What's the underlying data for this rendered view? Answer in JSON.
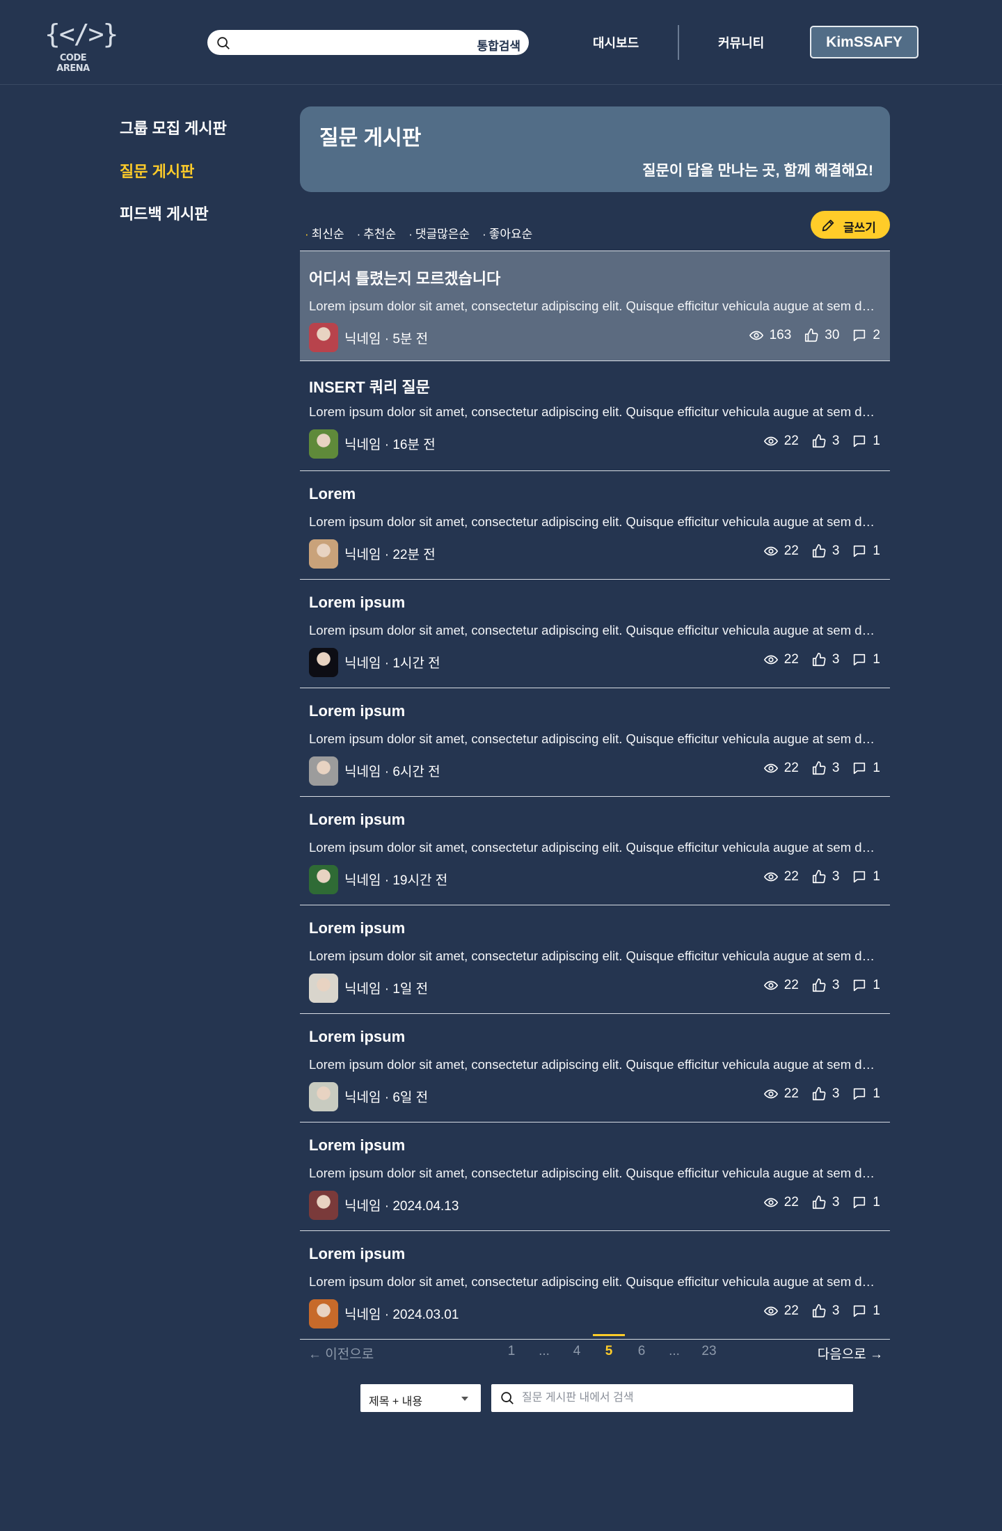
{
  "header": {
    "logo_text": "CODE ARENA",
    "search_label": "통합검색",
    "nav": [
      "대시보드",
      "커뮤니티"
    ],
    "user": "KimSSAFY"
  },
  "sidebar": {
    "items": [
      {
        "label": "그룹 모집 게시판",
        "active": false
      },
      {
        "label": "질문 게시판",
        "active": true
      },
      {
        "label": "피드백 게시판",
        "active": false
      }
    ]
  },
  "board": {
    "title": "질문 게시판",
    "subtitle": "질문이 답을 만나는 곳, 함께 해결해요!"
  },
  "sort": {
    "tabs": [
      "최신순",
      "추천순",
      "댓글많은순",
      "좋아요순"
    ],
    "active_index": 0
  },
  "write_label": "글쓰기",
  "posts": [
    {
      "title": "어디서 틀렸는지 모르겠습니다",
      "body": "Lorem ipsum dolor sit amet, consectetur adipiscing elit. Quisque efficitur vehicula augue at sem dapibus, non volutpat",
      "meta": "닉네임 · 5분 전",
      "views": "163",
      "likes": "30",
      "comments": "2",
      "highlight": true,
      "avatar_color": "#b8434c"
    },
    {
      "title": "INSERT 쿼리 질문",
      "body": "Lorem ipsum dolor sit amet, consectetur adipiscing elit. Quisque efficitur vehicula augue at sem dapibus, non volutpat",
      "meta": "닉네임 · 16분 전",
      "views": "22",
      "likes": "3",
      "comments": "1",
      "highlight": false,
      "avatar_color": "#5f8a3a"
    },
    {
      "title": "Lorem",
      "body": "Lorem ipsum dolor sit amet, consectetur adipiscing elit. Quisque efficitur vehicula augue at sem dapibus, non volutpat",
      "meta": "닉네임 · 22분 전",
      "views": "22",
      "likes": "3",
      "comments": "1",
      "highlight": false,
      "avatar_color": "#c9a27a"
    },
    {
      "title": "Lorem ipsum",
      "body": "Lorem ipsum dolor sit amet, consectetur adipiscing elit. Quisque efficitur vehicula augue at sem dapibus, non volutpat",
      "meta": "닉네임 · 1시간 전",
      "views": "22",
      "likes": "3",
      "comments": "1",
      "highlight": false,
      "avatar_color": "#0d0d14"
    },
    {
      "title": "Lorem ipsum",
      "body": "Lorem ipsum dolor sit amet, consectetur adipiscing elit. Quisque efficitur vehicula augue at sem dapibus, non volutpat",
      "meta": "닉네임 · 6시간 전",
      "views": "22",
      "likes": "3",
      "comments": "1",
      "highlight": false,
      "avatar_color": "#9c9c9c"
    },
    {
      "title": "Lorem ipsum",
      "body": "Lorem ipsum dolor sit amet, consectetur adipiscing elit. Quisque efficitur vehicula augue at sem dapibus, non volutpat",
      "meta": "닉네임 · 19시간 전",
      "views": "22",
      "likes": "3",
      "comments": "1",
      "highlight": false,
      "avatar_color": "#2f6b35"
    },
    {
      "title": "Lorem ipsum",
      "body": "Lorem ipsum dolor sit amet, consectetur adipiscing elit. Quisque efficitur vehicula augue at sem dapibus, non volutpat",
      "meta": "닉네임 · 1일 전",
      "views": "22",
      "likes": "3",
      "comments": "1",
      "highlight": false,
      "avatar_color": "#d9d5cc"
    },
    {
      "title": "Lorem ipsum",
      "body": "Lorem ipsum dolor sit amet, consectetur adipiscing elit. Quisque efficitur vehicula augue at sem dapibus, non volutpat",
      "meta": "닉네임 · 6일 전",
      "views": "22",
      "likes": "3",
      "comments": "1",
      "highlight": false,
      "avatar_color": "#c8cbc0"
    },
    {
      "title": "Lorem ipsum",
      "body": "Lorem ipsum dolor sit amet, consectetur adipiscing elit. Quisque efficitur vehicula augue at sem dapibus, non volutpat",
      "meta": "닉네임 · 2024.04.13",
      "views": "22",
      "likes": "3",
      "comments": "1",
      "highlight": false,
      "avatar_color": "#7a3a3a"
    },
    {
      "title": "Lorem ipsum",
      "body": "Lorem ipsum dolor sit amet, consectetur adipiscing elit. Quisque efficitur vehicula augue at sem dapibus, non volutpat",
      "meta": "닉네임 · 2024.03.01",
      "views": "22",
      "likes": "3",
      "comments": "1",
      "highlight": false,
      "avatar_color": "#c76a2a"
    }
  ],
  "pagination": {
    "prev": "← 이전으로",
    "next": "다음으로 →",
    "items": [
      "1",
      "...",
      "4",
      "5",
      "6",
      "...",
      "23"
    ],
    "active": "5"
  },
  "bottom_search": {
    "select_value": "제목 + 내용",
    "placeholder": "질문 게시판 내에서 검색"
  },
  "colors": {
    "background": "#253550",
    "accent": "#ffcc29",
    "panel": "#526d87",
    "highlight_row": "#5c6b80"
  }
}
